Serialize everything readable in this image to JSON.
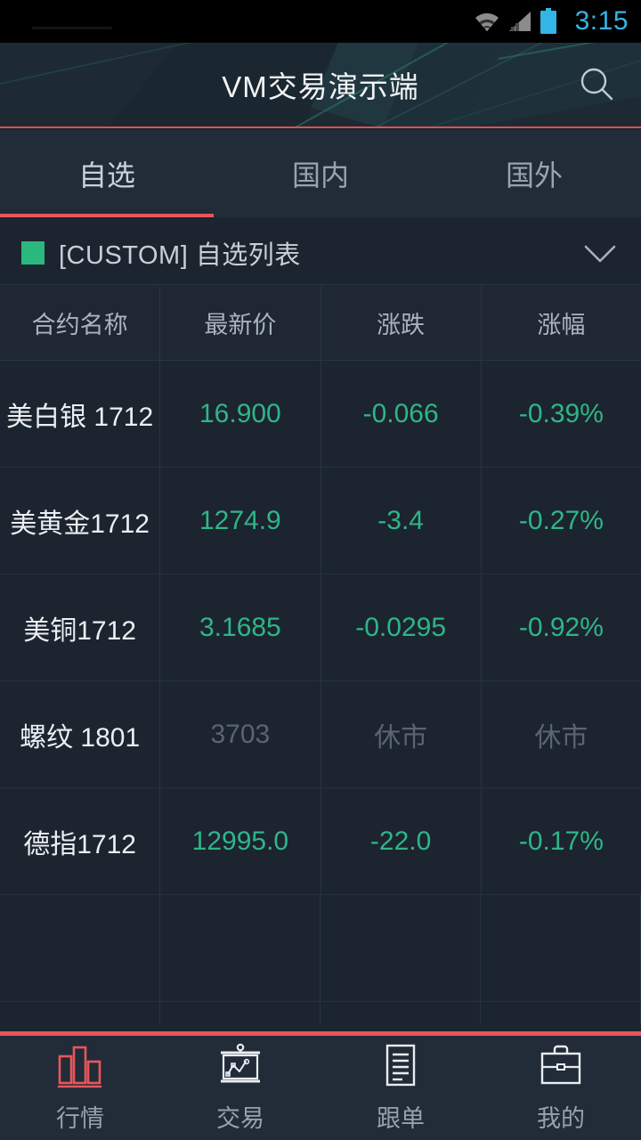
{
  "statusbar": {
    "time": "3:15",
    "wifi_icon": "wifi-icon",
    "signal_icon": "signal-bars-icon",
    "battery_icon": "battery-icon"
  },
  "header": {
    "title": "VM交易演示端",
    "search_icon": "search-icon"
  },
  "tabs": [
    {
      "label": "自选",
      "active": true
    },
    {
      "label": "国内",
      "active": false
    },
    {
      "label": "国外",
      "active": false
    }
  ],
  "group": {
    "indicator_color": "#2ab87e",
    "label": "[CUSTOM] 自选列表",
    "chevron_icon": "chevron-down-icon"
  },
  "table": {
    "columns": [
      "合约名称",
      "最新价",
      "涨跌",
      "涨幅"
    ],
    "rows": [
      {
        "name": "美白银 1712",
        "last": "16.900",
        "change": "-0.066",
        "percent": "-0.39%",
        "state": "down"
      },
      {
        "name": "美黄金1712",
        "last": "1274.9",
        "change": "-3.4",
        "percent": "-0.27%",
        "state": "down"
      },
      {
        "name": "美铜1712",
        "last": "3.1685",
        "change": "-0.0295",
        "percent": "-0.92%",
        "state": "down"
      },
      {
        "name": "螺纹 1801",
        "last": "3703",
        "change": "休市",
        "percent": "休市",
        "state": "closed"
      },
      {
        "name": "德指1712",
        "last": "12995.0",
        "change": "-22.0",
        "percent": "-0.17%",
        "state": "down"
      }
    ]
  },
  "bottom_nav": [
    {
      "label": "行情",
      "icon": "bar-chart-icon",
      "active": true
    },
    {
      "label": "交易",
      "icon": "chart-board-icon",
      "active": false
    },
    {
      "label": "跟单",
      "icon": "document-icon",
      "active": false
    },
    {
      "label": "我的",
      "icon": "briefcase-icon",
      "active": false
    }
  ],
  "colors": {
    "accent_red": "#e8565a",
    "down_green": "#2eb686",
    "closed_gray": "#5a6472",
    "status_blue": "#33b5e5",
    "page_bg": "#1c2430",
    "panel_bg": "#222b38"
  }
}
